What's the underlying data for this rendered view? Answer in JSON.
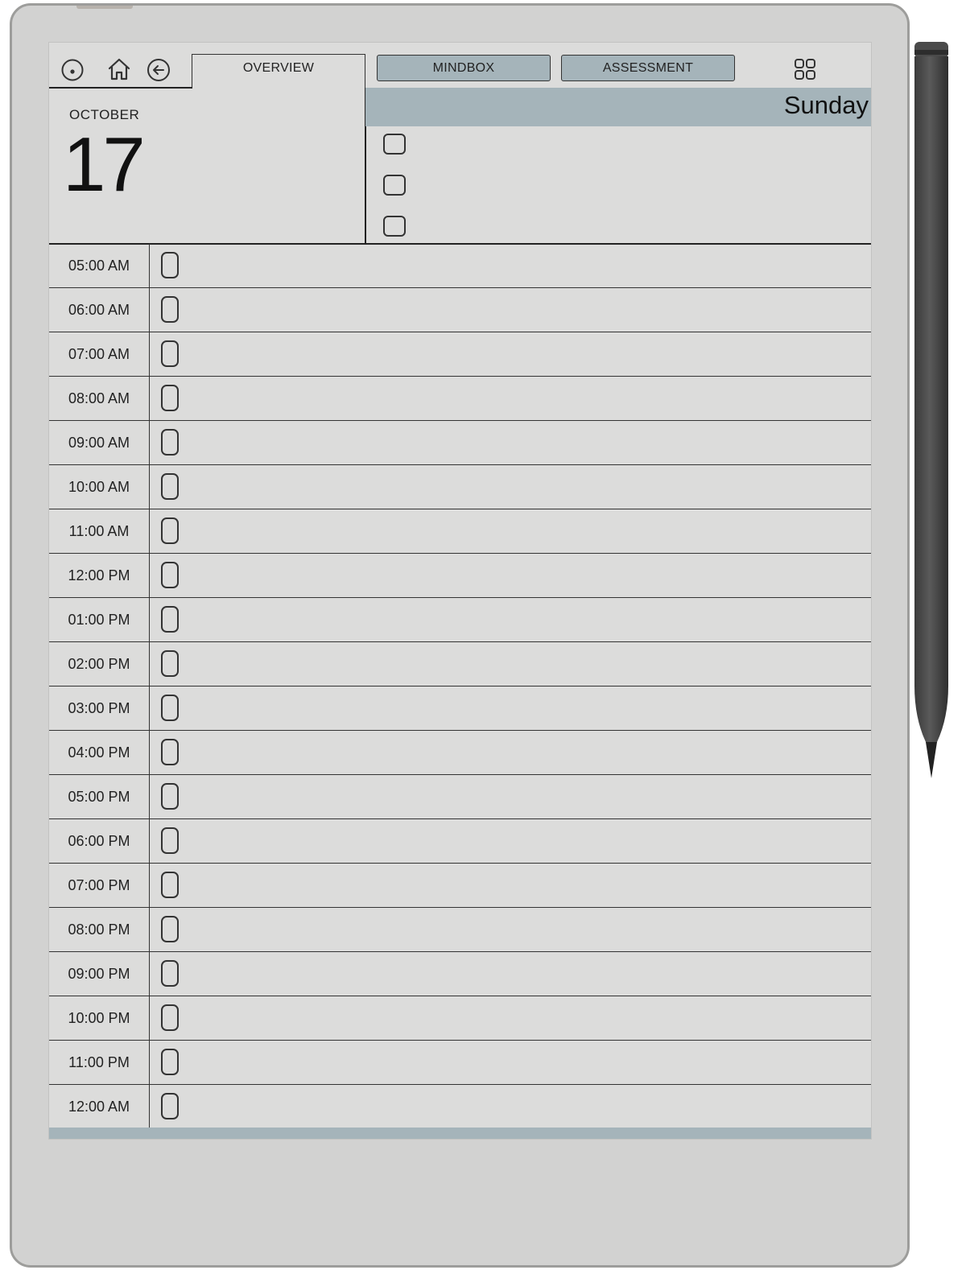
{
  "tabs": {
    "overview": "OVERVIEW",
    "mindbox": "MINDBOX",
    "assessment": "ASSESSMENT"
  },
  "date": {
    "month": "OCTOBER",
    "day": "17",
    "weekday": "Sunday"
  },
  "schedule": [
    "05:00 AM",
    "06:00 AM",
    "07:00 AM",
    "08:00 AM",
    "09:00 AM",
    "10:00 AM",
    "11:00 AM",
    "12:00 PM",
    "01:00 PM",
    "02:00 PM",
    "03:00 PM",
    "04:00 PM",
    "05:00 PM",
    "06:00 PM",
    "07:00 PM",
    "08:00 PM",
    "09:00 PM",
    "10:00 PM",
    "11:00 PM",
    "12:00 AM"
  ],
  "icons": {
    "sync": "sync-icon",
    "home": "home-icon",
    "back": "back-arrow-icon",
    "grid": "grid-menu-icon"
  },
  "colors": {
    "accent": "#a5b4ba",
    "screen": "#dcdcdb",
    "device": "#d2d2d1"
  }
}
